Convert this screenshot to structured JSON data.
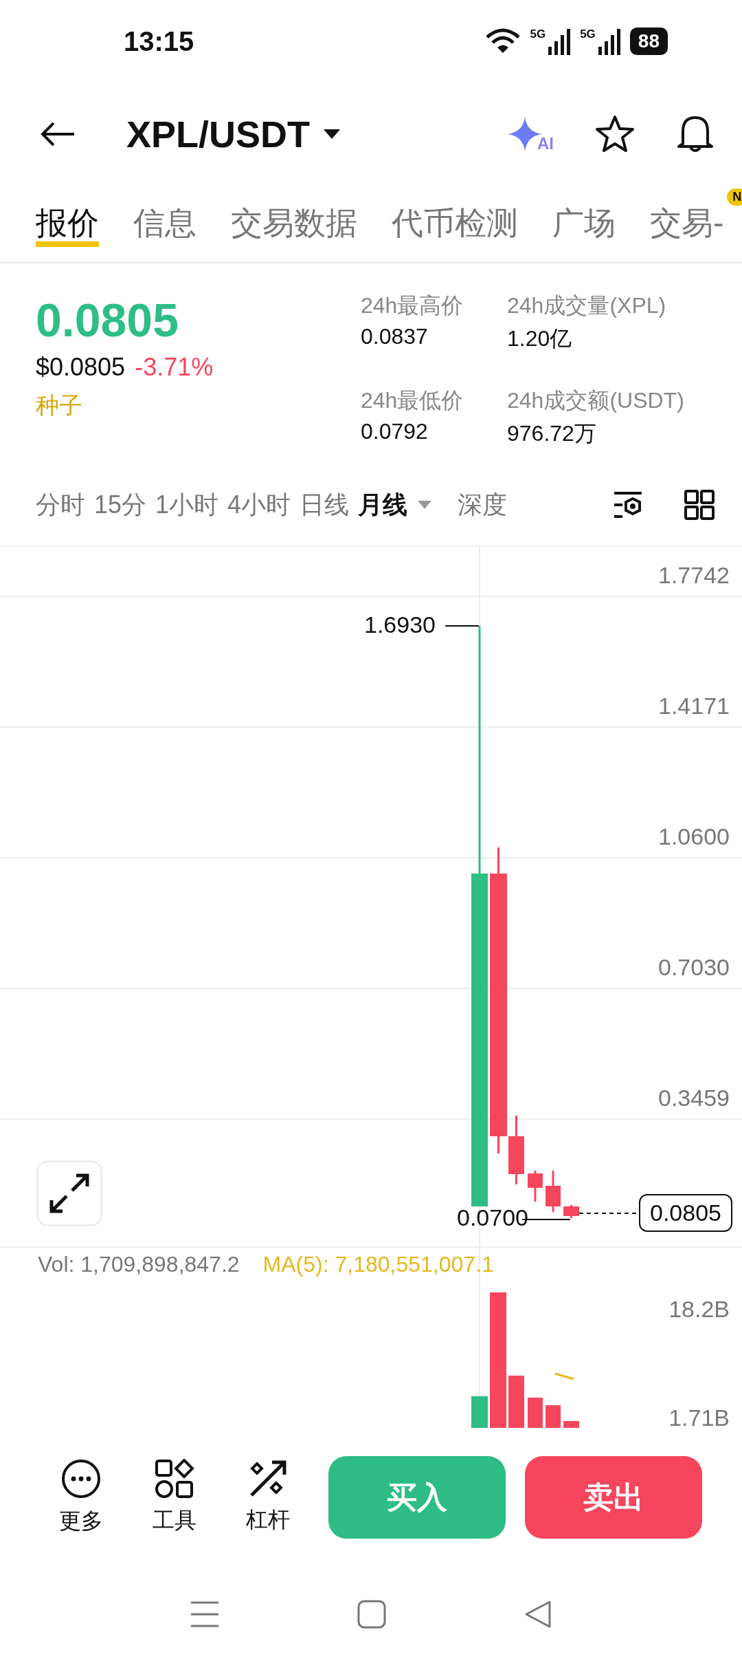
{
  "status_bar": {
    "time": "13:15",
    "network_labels": [
      "5G",
      "5G"
    ],
    "battery": "88"
  },
  "header": {
    "title": "XPL/USDT",
    "ai_label": "AI"
  },
  "tabs": [
    {
      "label": "报价",
      "selected": true
    },
    {
      "label": "信息",
      "selected": false
    },
    {
      "label": "交易数据",
      "selected": false
    },
    {
      "label": "代币检测",
      "selected": false
    },
    {
      "label": "广场",
      "selected": false
    },
    {
      "label": "交易-",
      "selected": false,
      "badge": "N"
    }
  ],
  "ticker": {
    "price": "0.0805",
    "usd_price": "$0.0805",
    "change": "-3.71%",
    "tag": "种子",
    "stats": [
      {
        "label": "24h最高价",
        "value": "0.0837"
      },
      {
        "label": "24h成交量(XPL)",
        "value": "1.20亿"
      },
      {
        "label": "24h最低价",
        "value": "0.0792"
      },
      {
        "label": "24h成交额(USDT)",
        "value": "976.72万"
      }
    ]
  },
  "intervals": [
    {
      "label": "分时",
      "selected": false
    },
    {
      "label": "15分",
      "selected": false
    },
    {
      "label": "1小时",
      "selected": false
    },
    {
      "label": "4小时",
      "selected": false
    },
    {
      "label": "日线",
      "selected": false
    },
    {
      "label": "月线",
      "selected": true,
      "kind": "dropdown"
    },
    {
      "label": "深度",
      "selected": false,
      "kind": "plain"
    }
  ],
  "price_chart": {
    "axis_labels": [
      "1.7742",
      "1.4171",
      "1.0600",
      "0.7030",
      "0.3459"
    ],
    "high_label": "1.6930",
    "low_label": "0.0700",
    "last_price": "0.0805"
  },
  "volume_chart": {
    "vol": "Vol: 1,709,898,847.2",
    "ma": "MA(5): 7,180,551,007.1",
    "axis_labels": [
      "18.2B",
      "1.71B"
    ]
  },
  "actions": [
    {
      "label": "更多",
      "kind": "more"
    },
    {
      "label": "工具",
      "kind": "tools"
    },
    {
      "label": "杠杆",
      "kind": "leverage"
    }
  ],
  "buy_label": "买入",
  "sell_label": "卖出"
}
